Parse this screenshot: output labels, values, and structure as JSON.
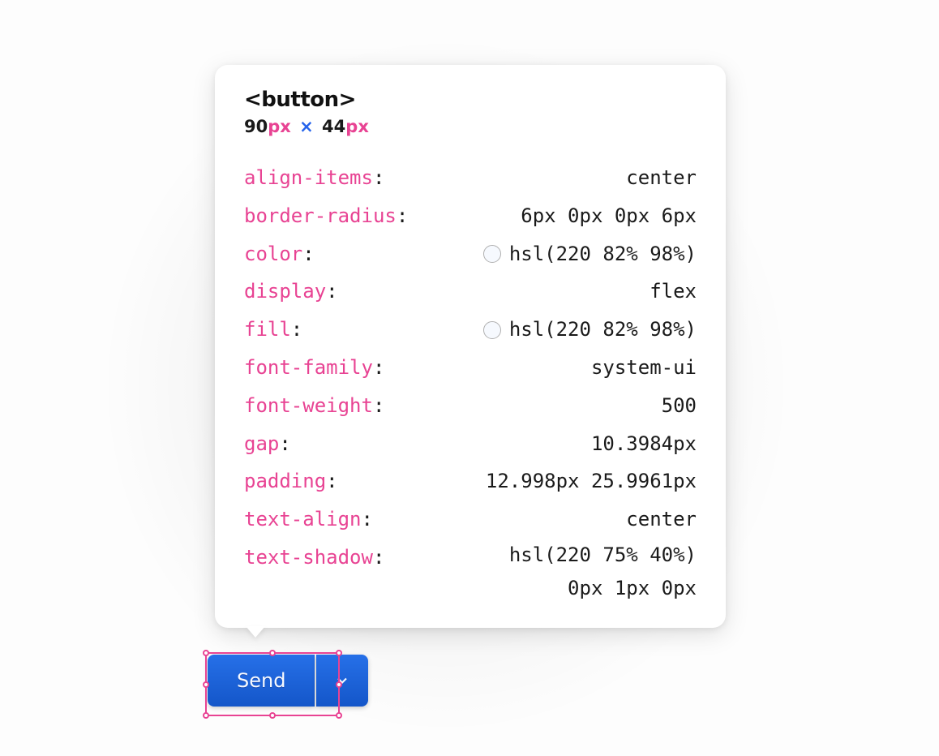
{
  "tooltip": {
    "element_tag": "<button>",
    "dimensions": {
      "width_num": "90",
      "width_unit": "px",
      "times": "×",
      "height_num": "44",
      "height_unit": "px"
    },
    "properties": [
      {
        "name": "align-items",
        "value": "center",
        "swatch": false
      },
      {
        "name": "border-radius",
        "value": "6px 0px 0px 6px",
        "swatch": false
      },
      {
        "name": "color",
        "value": "hsl(220 82% 98%)",
        "swatch": true
      },
      {
        "name": "display",
        "value": "flex",
        "swatch": false
      },
      {
        "name": "fill",
        "value": "hsl(220 82% 98%)",
        "swatch": true
      },
      {
        "name": "font-family",
        "value": "system-ui",
        "swatch": false
      },
      {
        "name": "font-weight",
        "value": "500",
        "swatch": false
      },
      {
        "name": "gap",
        "value": "10.3984px",
        "swatch": false
      },
      {
        "name": "padding",
        "value": "12.998px 25.9961px",
        "swatch": false
      },
      {
        "name": "text-align",
        "value": "center",
        "swatch": false
      },
      {
        "name": "text-shadow",
        "value_line1": "hsl(220 75% 40%)",
        "value_line2": "0px 1px 0px",
        "swatch": false,
        "multiline": true
      }
    ]
  },
  "buttons": {
    "send_label": "Send"
  }
}
